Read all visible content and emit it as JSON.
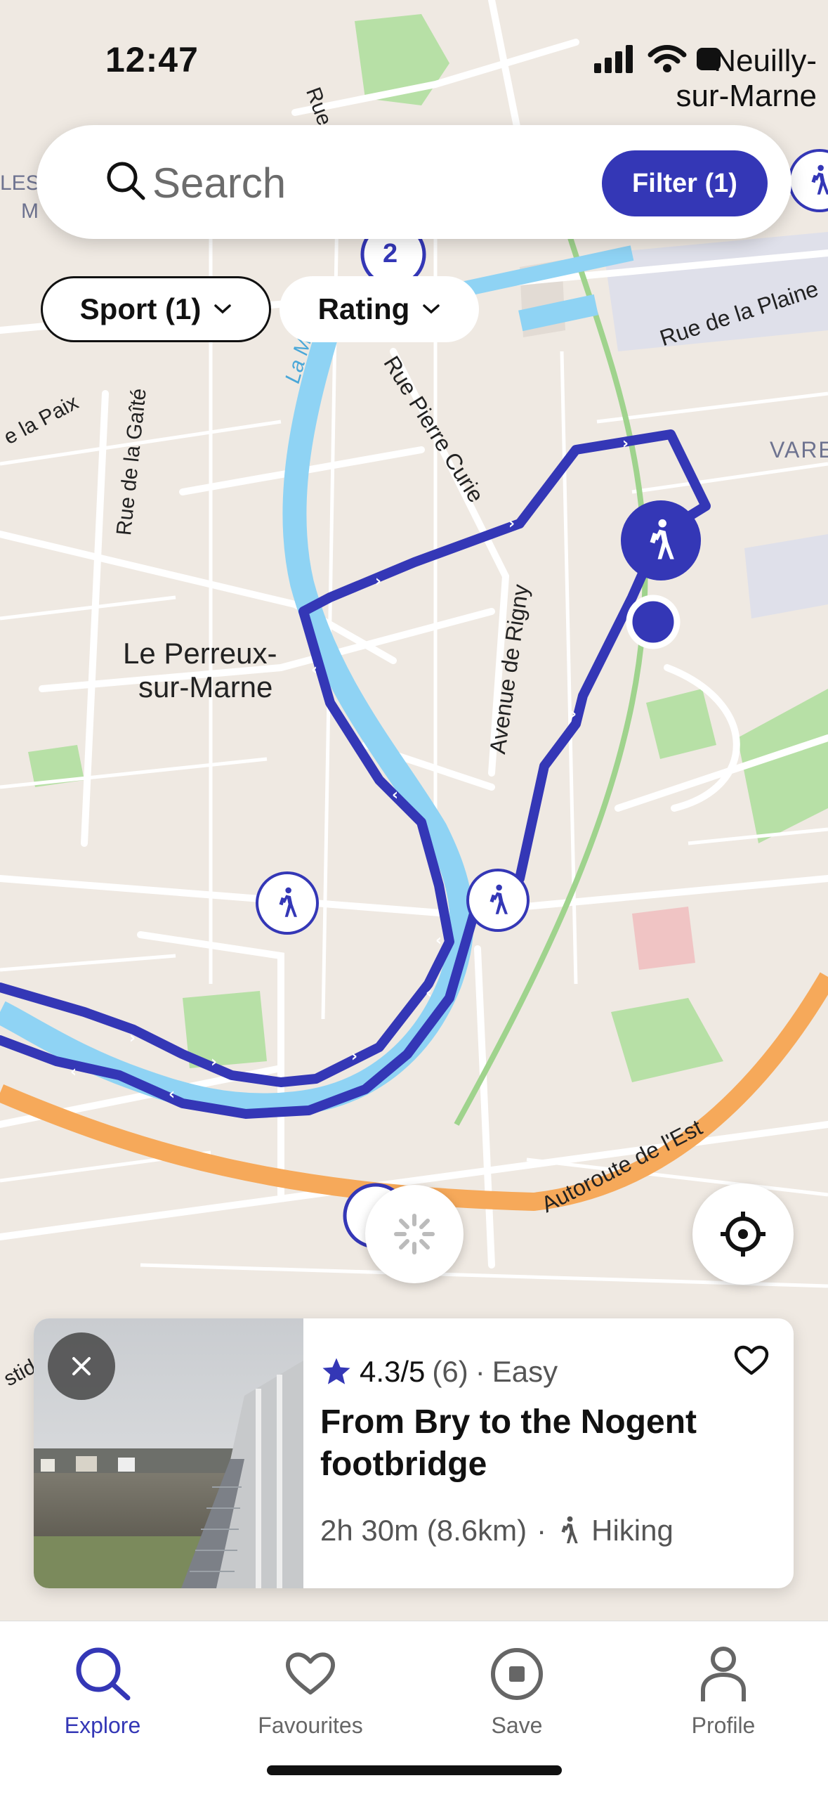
{
  "status_bar": {
    "time": "12:47",
    "location_label_line1": "Neuilly-",
    "location_label_line2": "sur-Marne"
  },
  "search": {
    "placeholder": "Search",
    "filter_label": "Filter (1)"
  },
  "chips": [
    {
      "label": "Sport (1)",
      "active": true
    },
    {
      "label": "Rating",
      "active": false
    }
  ],
  "map": {
    "cluster_badge": "2",
    "labels": {
      "town": [
        "Le Perreux-",
        "sur-Marne"
      ],
      "river": "La Marne",
      "rue_pierre_curie": "Rue Pierre Curie",
      "rue_de_la_gaite": "Rue de la Gaîté",
      "rue_de_la_paix": "e la Paix",
      "avenue_de_rigny": "Avenue de Rigny",
      "rue_de_la_plaine": "Rue de la Plaine",
      "autoroute": "Autoroute de l'Est",
      "varenne": "VARE",
      "rue_top": "Rue",
      "les_left": "LES",
      "m_left": "M",
      "stide": "stide"
    },
    "route_color": "#3437b6",
    "river_color": "#8fd3f4"
  },
  "route_card": {
    "rating": "4.3/5",
    "review_count": "(6)",
    "separator": "·",
    "difficulty": "Easy",
    "title": "From Bry to the Nogent footbridge",
    "duration_distance": "2h 30m (8.6km)",
    "sport": "Hiking"
  },
  "tabs": [
    {
      "label": "Explore",
      "icon": "search-icon",
      "active": true
    },
    {
      "label": "Favourites",
      "icon": "heart-icon",
      "active": false
    },
    {
      "label": "Save",
      "icon": "record-icon",
      "active": false
    },
    {
      "label": "Profile",
      "icon": "person-icon",
      "active": false
    }
  ],
  "colors": {
    "accent": "#3437b6",
    "map_bg": "#efe9e2",
    "park": "#b7e0a6",
    "highway": "#f6a95a"
  }
}
